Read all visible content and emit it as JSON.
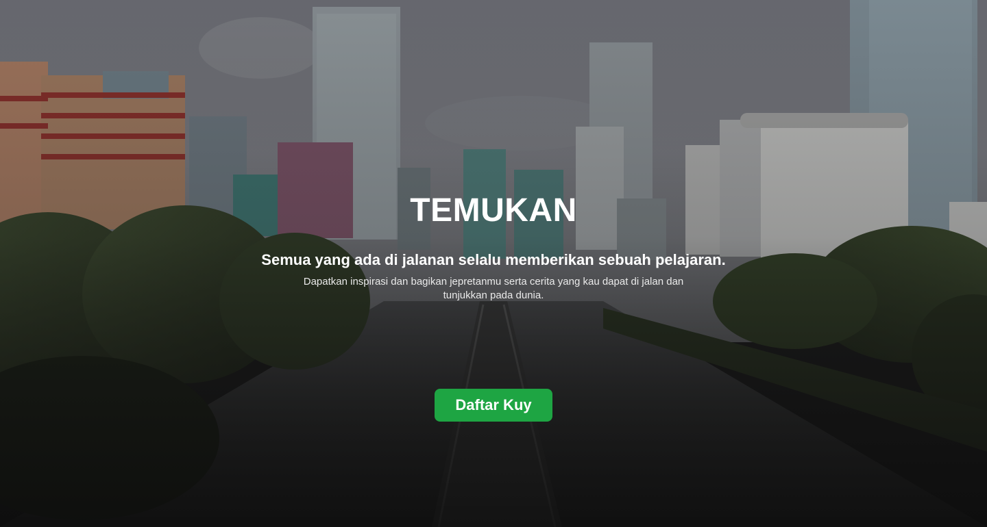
{
  "hero": {
    "title": "TEMUKAN",
    "tagline": "Semua yang ada di jalanan selalu memberikan sebuah pelajaran.",
    "description_line1": "Dapatkan inspirasi dan bagikan jepretanmu serta cerita yang kau dapat  di jalan dan",
    "description_line2": "tunjukkan pada dunia.",
    "cta_label": "Daftar Kuy"
  },
  "colors": {
    "cta_background": "#1ea543",
    "text": "#ffffff",
    "sky": "#7a7b82",
    "foliage": "#2e3a25",
    "road": "#3a3b3c"
  }
}
